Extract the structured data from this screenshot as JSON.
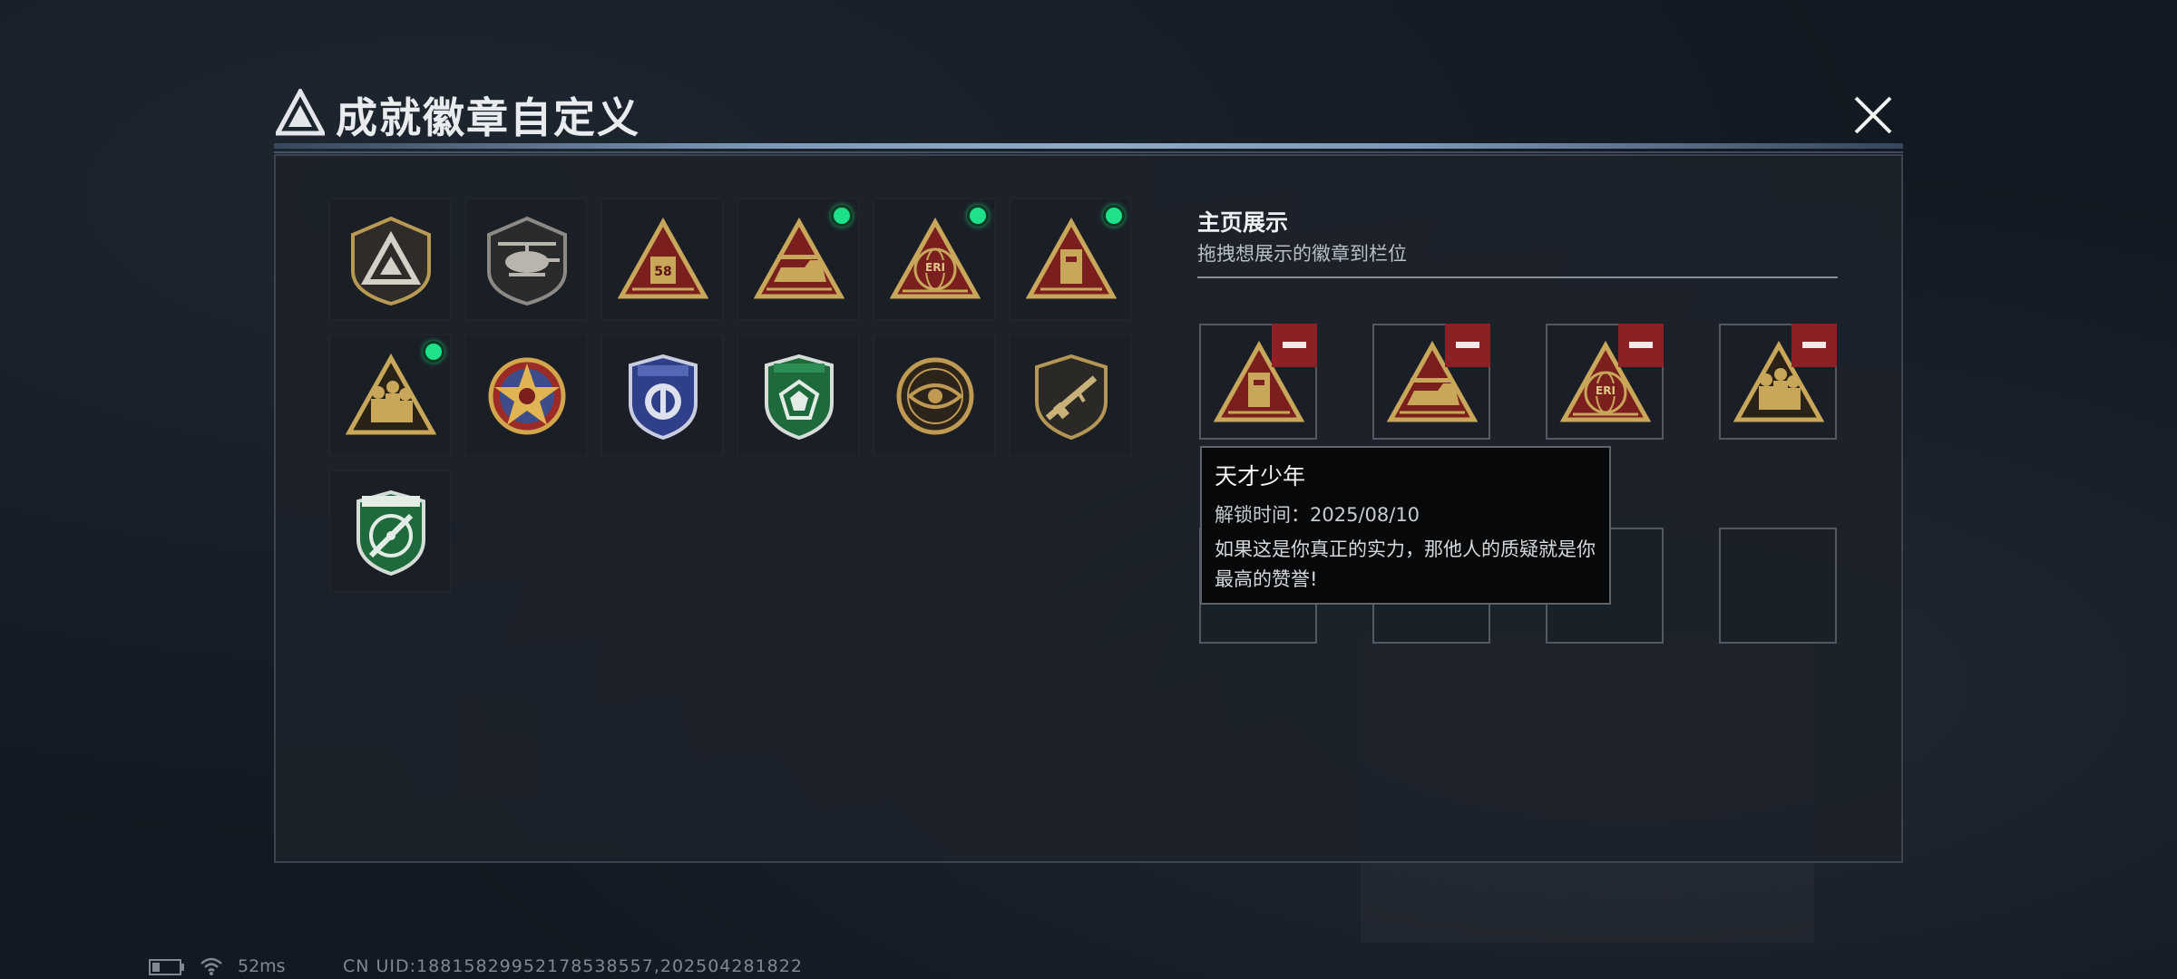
{
  "window": {
    "title": "成就徽章自定义"
  },
  "badges": [
    {
      "icon": "triangle-logo-shield-badge",
      "selected": false
    },
    {
      "icon": "helicopter-shield-badge",
      "selected": false
    },
    {
      "icon": "triangle-58-badge",
      "selected": false
    },
    {
      "icon": "triangle-vehicle-badge",
      "selected": true
    },
    {
      "icon": "triangle-eri-globe-badge",
      "selected": true
    },
    {
      "icon": "triangle-device-badge",
      "selected": true
    },
    {
      "icon": "triangle-soldiers-badge",
      "selected": true
    },
    {
      "icon": "star-medal-badge",
      "selected": false
    },
    {
      "icon": "police-shield-badge",
      "selected": false
    },
    {
      "icon": "green-gem-shield-badge",
      "selected": false
    },
    {
      "icon": "eye-coin-badge",
      "selected": false
    },
    {
      "icon": "rifle-shield-badge",
      "selected": false
    },
    {
      "icon": "green-crosshair-badge",
      "selected": false
    }
  ],
  "showcase": {
    "title": "主页展示",
    "subtitle": "拖拽想展示的徽章到栏位",
    "slots": [
      {
        "icon": "triangle-device-badge",
        "filled": true
      },
      {
        "icon": "triangle-vehicle-badge",
        "filled": true
      },
      {
        "icon": "triangle-eri-globe-badge",
        "filled": true
      },
      {
        "icon": "triangle-soldiers-badge",
        "filled": true
      },
      {
        "filled": false
      },
      {
        "filled": false
      },
      {
        "filled": false
      },
      {
        "filled": false
      }
    ]
  },
  "tooltip": {
    "title": "天才少年",
    "unlock_time": "解锁时间：2025/08/10",
    "description": "如果这是你真正的实力，那他人的质疑就是你最高的赞誉!"
  },
  "status": {
    "ping": "52ms",
    "uid": "CN UID:18815829952178538557,202504281822"
  },
  "colors": {
    "background": "#131922",
    "panel": "#1c222a",
    "gold": "#c9a75a",
    "badge_red": "#7a1e1e",
    "remove_red": "#8d2024",
    "selected_green": "#1ee18a"
  }
}
